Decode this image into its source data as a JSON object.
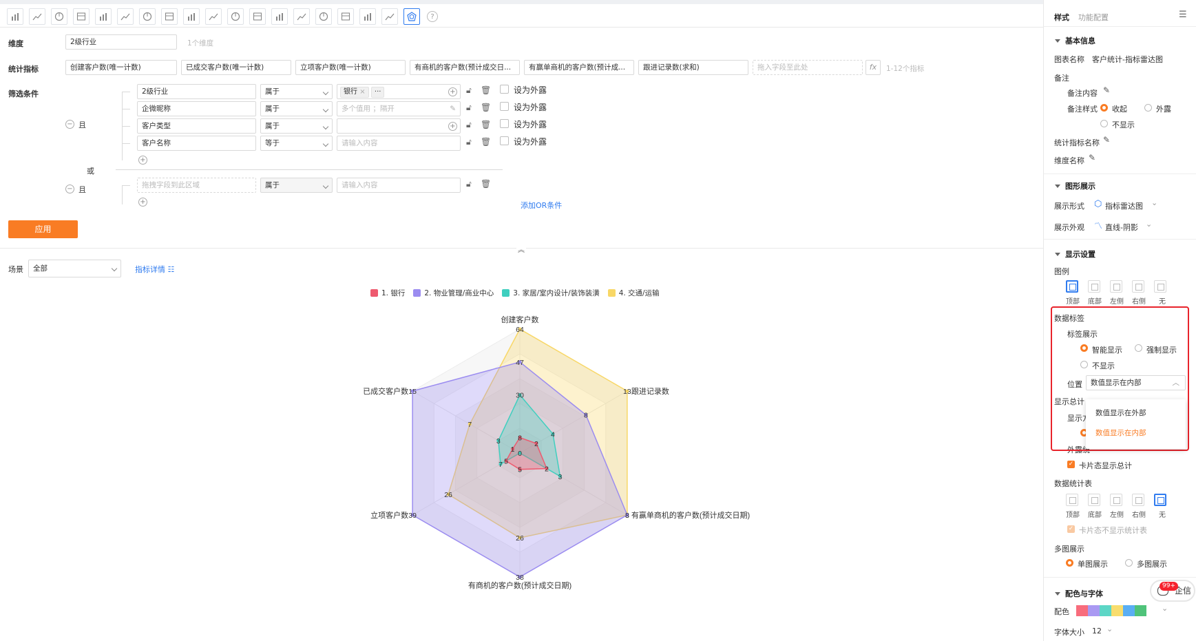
{
  "toolbar": {
    "chart_types": [
      "bar-chart-icon",
      "line-chart-icon",
      "pie-chart-icon",
      "funnel-chart-icon",
      "funnel2-chart-icon",
      "table-icon",
      "combo-chart-icon",
      "card-icon",
      "gauge-icon",
      "map-icon",
      "map2-icon",
      "geo-icon",
      "bubble-icon",
      "column-icon",
      "scatter-icon",
      "heatmap-icon",
      "pivot-icon",
      "trend-icon",
      "radar-chart-icon"
    ],
    "help": "?"
  },
  "dimension": {
    "label": "维度",
    "value": "2级行业",
    "hint": "1个维度"
  },
  "metrics": {
    "label": "统计指标",
    "items": [
      "创建客户数(唯一计数)",
      "已成交客户数(唯一计数)",
      "立项客户数(唯一计数)",
      "有商机的客户数(预计成交日...",
      "有赢单商机的客户数(预计成...",
      "跟进记录数(求和)"
    ],
    "placeholder": "拖入字段至此处",
    "fx": "fx",
    "hint": "1-12个指标"
  },
  "filters": {
    "label": "筛选条件",
    "and_label": "且",
    "or_label": "或",
    "group1": [
      {
        "field": "2级行业",
        "op": "属于",
        "value_tag": "银行",
        "more": "···",
        "ext": "设为外露"
      },
      {
        "field": "企微昵称",
        "op": "属于",
        "value_placeholder": "多个值用 ；隔开",
        "ext": "设为外露"
      },
      {
        "field": "客户类型",
        "op": "属于",
        "value_placeholder": "",
        "ext": "设为外露"
      },
      {
        "field": "客户名称",
        "op": "等于",
        "value_placeholder": "请输入内容",
        "ext": "设为外露"
      }
    ],
    "group2": {
      "field_placeholder": "拖拽字段到此区域",
      "op": "属于",
      "value_placeholder": "请输入内容"
    },
    "add_or": "添加OR条件"
  },
  "apply_label": "应用",
  "scene": {
    "label": "场景",
    "value": "全部",
    "detail_link": "指标详情"
  },
  "chart_data": {
    "type": "radar",
    "indicators": [
      "创建客户数",
      "跟进记录数",
      "有赢单商机的客户数(预计成交日期)",
      "有商机的客户数(预计成交日期)",
      "立项客户数",
      "已成交客户数"
    ],
    "max": [
      64,
      13,
      8,
      38,
      39,
      15
    ],
    "series": [
      {
        "name": "1. 银行",
        "color": "#ee5a6f",
        "values": [
          8,
          2,
          2,
          5,
          5,
          1
        ]
      },
      {
        "name": "2. 物业管理/商业中心",
        "color": "#9b8cf0",
        "values": [
          47,
          8,
          8,
          38,
          39,
          15
        ]
      },
      {
        "name": "3. 家居/室内设计/装饰装潢",
        "color": "#3fcfbf",
        "values": [
          30,
          4,
          3,
          0,
          7,
          3
        ]
      },
      {
        "name": "4. 交通/运输",
        "color": "#f8d766",
        "values": [
          64,
          13,
          8,
          26,
          26,
          7
        ]
      }
    ]
  },
  "panel": {
    "tab_style": "样式",
    "tab_config": "功能配置",
    "basic": {
      "title": "基本信息",
      "chart_name_label": "图表名称",
      "chart_name": "客户统计-指标雷达图",
      "remark": "备注",
      "remark_content": "备注内容",
      "remark_style": "备注样式",
      "opt_collapse": "收起",
      "opt_expose": "外露",
      "opt_hide": "不显示",
      "metric_name": "统计指标名称",
      "dim_name": "维度名称"
    },
    "graph": {
      "title": "图形展示",
      "form_label": "展示形式",
      "form_value": "指标雷达图",
      "look_label": "展示外观",
      "look_value": "直线-阴影"
    },
    "display": {
      "title": "显示设置",
      "legend": "图例",
      "positions": [
        "顶部",
        "底部",
        "左侧",
        "右侧",
        "无"
      ],
      "data_label": "数据标签",
      "label_show": "标签展示",
      "smart": "智能显示",
      "force": "强制显示",
      "none": "不显示",
      "position_label": "位置",
      "position_value": "数值显示在内部",
      "menu": [
        "数值显示在外部",
        "数值显示在内部"
      ],
      "total": "显示总计",
      "total_mode": "显示方",
      "expose": "外露统",
      "card_total": "卡片态显示总计",
      "stat_table": "数据统计表",
      "card_no_table": "卡片态不显示统计表",
      "multi": "多图展示",
      "single": "单图展示",
      "multi_opt": "多图展示"
    },
    "color_font": {
      "title": "配色与字体",
      "palette_label": "配色",
      "palette": [
        "#f86c7c",
        "#a999f2",
        "#5dd6c6",
        "#f8dd6e",
        "#5aaef3",
        "#4fc37a"
      ],
      "font_size_label": "字体大小",
      "font_size": "12"
    },
    "chat": {
      "label": "企信",
      "badge": "99+"
    }
  }
}
